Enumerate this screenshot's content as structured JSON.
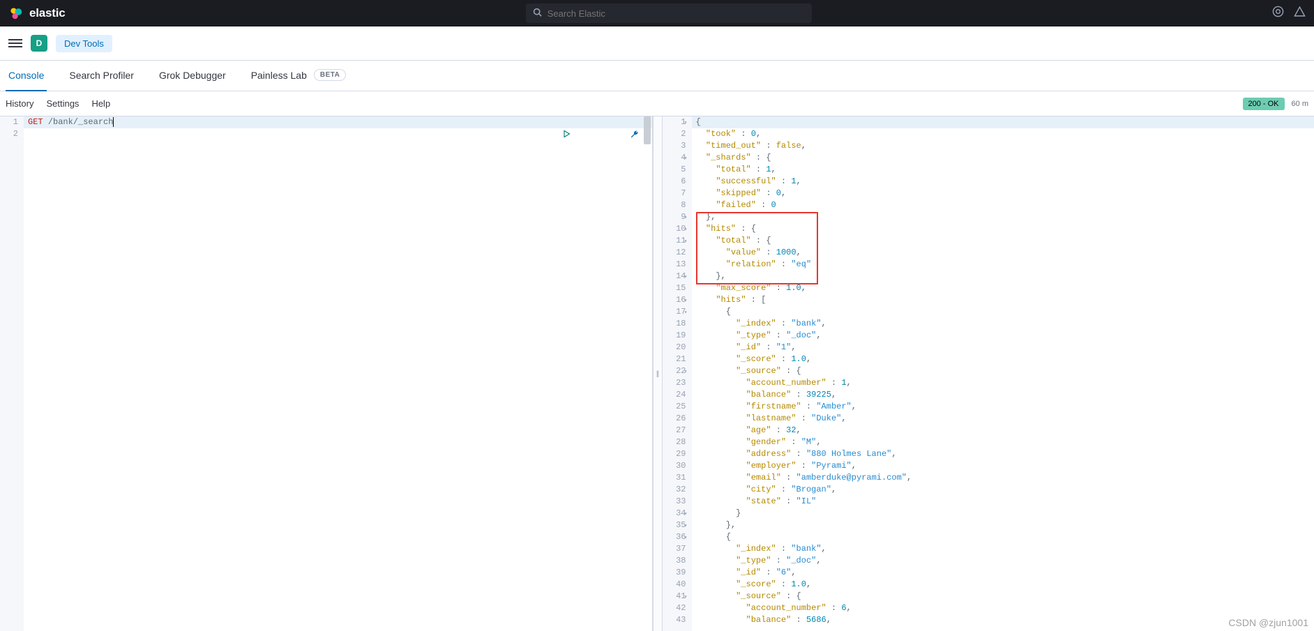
{
  "topbar": {
    "brand": "elastic",
    "search_placeholder": "Search Elastic"
  },
  "navbar": {
    "space_letter": "D",
    "breadcrumb": "Dev Tools"
  },
  "tabs": [
    {
      "label": "Console",
      "active": true
    },
    {
      "label": "Search Profiler"
    },
    {
      "label": "Grok Debugger"
    },
    {
      "label": "Painless Lab",
      "badge": "BETA"
    }
  ],
  "toolbar": {
    "history": "History",
    "settings": "Settings",
    "help": "Help",
    "status": "200 - OK",
    "timing": "60 m"
  },
  "request": {
    "lines": [
      "1",
      "2"
    ],
    "method": "GET",
    "path": "/bank/_search"
  },
  "response": {
    "line_count": 43,
    "fold_lines": [
      1,
      4,
      9,
      10,
      11,
      14,
      16,
      17,
      22,
      34,
      35,
      36,
      41
    ],
    "tokens": [
      [
        [
          "punc",
          "{"
        ]
      ],
      [
        [
          "sp",
          "  "
        ],
        [
          "key",
          "\"took\""
        ],
        [
          "punc",
          " : "
        ],
        [
          "num",
          "0"
        ],
        [
          "punc",
          ","
        ]
      ],
      [
        [
          "sp",
          "  "
        ],
        [
          "key",
          "\"timed_out\""
        ],
        [
          "punc",
          " : "
        ],
        [
          "bool",
          "false"
        ],
        [
          "punc",
          ","
        ]
      ],
      [
        [
          "sp",
          "  "
        ],
        [
          "key",
          "\"_shards\""
        ],
        [
          "punc",
          " : {"
        ]
      ],
      [
        [
          "sp",
          "    "
        ],
        [
          "key",
          "\"total\""
        ],
        [
          "punc",
          " : "
        ],
        [
          "num",
          "1"
        ],
        [
          "punc",
          ","
        ]
      ],
      [
        [
          "sp",
          "    "
        ],
        [
          "key",
          "\"successful\""
        ],
        [
          "punc",
          " : "
        ],
        [
          "num",
          "1"
        ],
        [
          "punc",
          ","
        ]
      ],
      [
        [
          "sp",
          "    "
        ],
        [
          "key",
          "\"skipped\""
        ],
        [
          "punc",
          " : "
        ],
        [
          "num",
          "0"
        ],
        [
          "punc",
          ","
        ]
      ],
      [
        [
          "sp",
          "    "
        ],
        [
          "key",
          "\"failed\""
        ],
        [
          "punc",
          " : "
        ],
        [
          "num",
          "0"
        ]
      ],
      [
        [
          "sp",
          "  "
        ],
        [
          "punc",
          "},"
        ]
      ],
      [
        [
          "sp",
          "  "
        ],
        [
          "key",
          "\"hits\""
        ],
        [
          "punc",
          " : {"
        ]
      ],
      [
        [
          "sp",
          "    "
        ],
        [
          "key",
          "\"total\""
        ],
        [
          "punc",
          " : {"
        ]
      ],
      [
        [
          "sp",
          "      "
        ],
        [
          "key",
          "\"value\""
        ],
        [
          "punc",
          " : "
        ],
        [
          "num",
          "1000"
        ],
        [
          "punc",
          ","
        ]
      ],
      [
        [
          "sp",
          "      "
        ],
        [
          "key",
          "\"relation\""
        ],
        [
          "punc",
          " : "
        ],
        [
          "str",
          "\"eq\""
        ]
      ],
      [
        [
          "sp",
          "    "
        ],
        [
          "punc",
          "},"
        ]
      ],
      [
        [
          "sp",
          "    "
        ],
        [
          "key",
          "\"max_score\""
        ],
        [
          "punc",
          " : "
        ],
        [
          "num",
          "1.0"
        ],
        [
          "punc",
          ","
        ]
      ],
      [
        [
          "sp",
          "    "
        ],
        [
          "key",
          "\"hits\""
        ],
        [
          "punc",
          " : ["
        ]
      ],
      [
        [
          "sp",
          "      "
        ],
        [
          "punc",
          "{"
        ]
      ],
      [
        [
          "sp",
          "        "
        ],
        [
          "key",
          "\"_index\""
        ],
        [
          "punc",
          " : "
        ],
        [
          "str",
          "\"bank\""
        ],
        [
          "punc",
          ","
        ]
      ],
      [
        [
          "sp",
          "        "
        ],
        [
          "key",
          "\"_type\""
        ],
        [
          "punc",
          " : "
        ],
        [
          "str",
          "\"_doc\""
        ],
        [
          "punc",
          ","
        ]
      ],
      [
        [
          "sp",
          "        "
        ],
        [
          "key",
          "\"_id\""
        ],
        [
          "punc",
          " : "
        ],
        [
          "str",
          "\"1\""
        ],
        [
          "punc",
          ","
        ]
      ],
      [
        [
          "sp",
          "        "
        ],
        [
          "key",
          "\"_score\""
        ],
        [
          "punc",
          " : "
        ],
        [
          "num",
          "1.0"
        ],
        [
          "punc",
          ","
        ]
      ],
      [
        [
          "sp",
          "        "
        ],
        [
          "key",
          "\"_source\""
        ],
        [
          "punc",
          " : {"
        ]
      ],
      [
        [
          "sp",
          "          "
        ],
        [
          "key",
          "\"account_number\""
        ],
        [
          "punc",
          " : "
        ],
        [
          "num",
          "1"
        ],
        [
          "punc",
          ","
        ]
      ],
      [
        [
          "sp",
          "          "
        ],
        [
          "key",
          "\"balance\""
        ],
        [
          "punc",
          " : "
        ],
        [
          "num",
          "39225"
        ],
        [
          "punc",
          ","
        ]
      ],
      [
        [
          "sp",
          "          "
        ],
        [
          "key",
          "\"firstname\""
        ],
        [
          "punc",
          " : "
        ],
        [
          "str",
          "\"Amber\""
        ],
        [
          "punc",
          ","
        ]
      ],
      [
        [
          "sp",
          "          "
        ],
        [
          "key",
          "\"lastname\""
        ],
        [
          "punc",
          " : "
        ],
        [
          "str",
          "\"Duke\""
        ],
        [
          "punc",
          ","
        ]
      ],
      [
        [
          "sp",
          "          "
        ],
        [
          "key",
          "\"age\""
        ],
        [
          "punc",
          " : "
        ],
        [
          "num",
          "32"
        ],
        [
          "punc",
          ","
        ]
      ],
      [
        [
          "sp",
          "          "
        ],
        [
          "key",
          "\"gender\""
        ],
        [
          "punc",
          " : "
        ],
        [
          "str",
          "\"M\""
        ],
        [
          "punc",
          ","
        ]
      ],
      [
        [
          "sp",
          "          "
        ],
        [
          "key",
          "\"address\""
        ],
        [
          "punc",
          " : "
        ],
        [
          "str",
          "\"880 Holmes Lane\""
        ],
        [
          "punc",
          ","
        ]
      ],
      [
        [
          "sp",
          "          "
        ],
        [
          "key",
          "\"employer\""
        ],
        [
          "punc",
          " : "
        ],
        [
          "str",
          "\"Pyrami\""
        ],
        [
          "punc",
          ","
        ]
      ],
      [
        [
          "sp",
          "          "
        ],
        [
          "key",
          "\"email\""
        ],
        [
          "punc",
          " : "
        ],
        [
          "str",
          "\"amberduke@pyrami.com\""
        ],
        [
          "punc",
          ","
        ]
      ],
      [
        [
          "sp",
          "          "
        ],
        [
          "key",
          "\"city\""
        ],
        [
          "punc",
          " : "
        ],
        [
          "str",
          "\"Brogan\""
        ],
        [
          "punc",
          ","
        ]
      ],
      [
        [
          "sp",
          "          "
        ],
        [
          "key",
          "\"state\""
        ],
        [
          "punc",
          " : "
        ],
        [
          "str",
          "\"IL\""
        ]
      ],
      [
        [
          "sp",
          "        "
        ],
        [
          "punc",
          "}"
        ]
      ],
      [
        [
          "sp",
          "      "
        ],
        [
          "punc",
          "},"
        ]
      ],
      [
        [
          "sp",
          "      "
        ],
        [
          "punc",
          "{"
        ]
      ],
      [
        [
          "sp",
          "        "
        ],
        [
          "key",
          "\"_index\""
        ],
        [
          "punc",
          " : "
        ],
        [
          "str",
          "\"bank\""
        ],
        [
          "punc",
          ","
        ]
      ],
      [
        [
          "sp",
          "        "
        ],
        [
          "key",
          "\"_type\""
        ],
        [
          "punc",
          " : "
        ],
        [
          "str",
          "\"_doc\""
        ],
        [
          "punc",
          ","
        ]
      ],
      [
        [
          "sp",
          "        "
        ],
        [
          "key",
          "\"_id\""
        ],
        [
          "punc",
          " : "
        ],
        [
          "str",
          "\"6\""
        ],
        [
          "punc",
          ","
        ]
      ],
      [
        [
          "sp",
          "        "
        ],
        [
          "key",
          "\"_score\""
        ],
        [
          "punc",
          " : "
        ],
        [
          "num",
          "1.0"
        ],
        [
          "punc",
          ","
        ]
      ],
      [
        [
          "sp",
          "        "
        ],
        [
          "key",
          "\"_source\""
        ],
        [
          "punc",
          " : {"
        ]
      ],
      [
        [
          "sp",
          "          "
        ],
        [
          "key",
          "\"account_number\""
        ],
        [
          "punc",
          " : "
        ],
        [
          "num",
          "6"
        ],
        [
          "punc",
          ","
        ]
      ],
      [
        [
          "sp",
          "          "
        ],
        [
          "key",
          "\"balance\""
        ],
        [
          "punc",
          " : "
        ],
        [
          "num",
          "5686"
        ],
        [
          "punc",
          ","
        ]
      ]
    ]
  },
  "watermark": "CSDN @zjun1001"
}
